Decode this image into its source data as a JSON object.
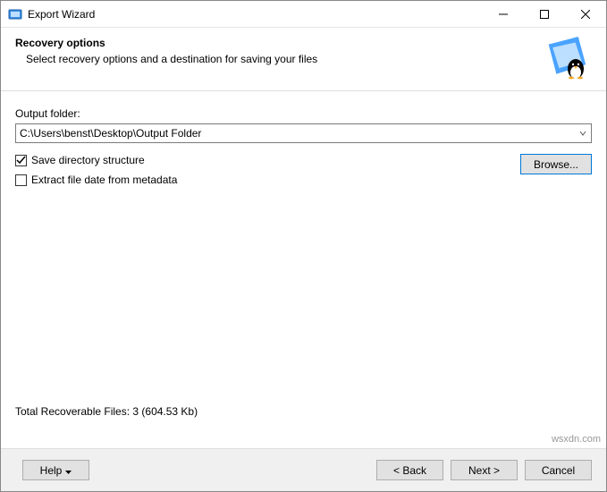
{
  "window": {
    "title": "Export Wizard"
  },
  "header": {
    "title": "Recovery options",
    "subtitle": "Select recovery options and a destination for saving your files"
  },
  "output": {
    "label": "Output folder:",
    "value": "C:\\Users\\benst\\Desktop\\Output Folder"
  },
  "options": {
    "save_structure": "Save directory structure",
    "extract_date": "Extract file date from metadata"
  },
  "buttons": {
    "browse": "Browse...",
    "help": "Help",
    "back": "< Back",
    "next": "Next >",
    "cancel": "Cancel"
  },
  "stats": {
    "text": "Total Recoverable Files: 3 (604.53 Kb)"
  },
  "watermark": "wsxdn.com"
}
